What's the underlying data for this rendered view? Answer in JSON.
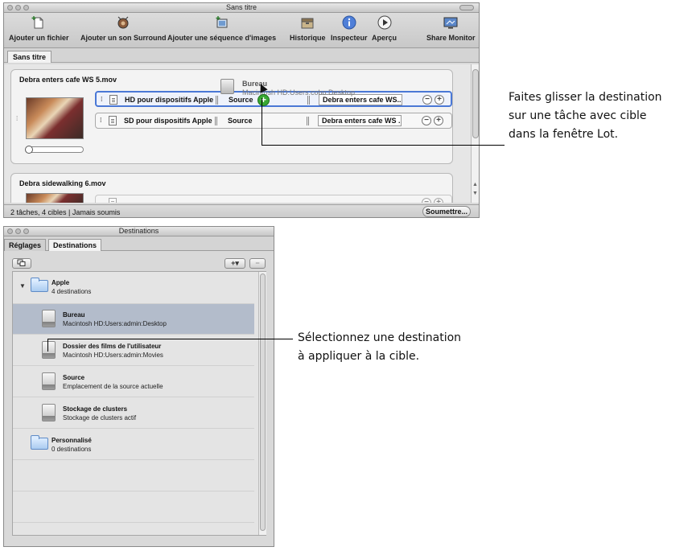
{
  "batch_window": {
    "title": "Sans titre",
    "toolbar": {
      "add_file": "Ajouter un fichier",
      "add_surround": "Ajouter un son Surround",
      "add_sequence": "Ajouter une séquence d'images",
      "history": "Historique",
      "inspector": "Inspecteur",
      "preview": "Aperçu",
      "share_monitor": "Share Monitor"
    },
    "tab": "Sans titre",
    "jobs": [
      {
        "name": "Debra enters cafe WS 5.mov",
        "targets": [
          {
            "setting": "HD pour dispositifs Apple",
            "destination": "Source",
            "output": "Debra enters cafe WS..."
          },
          {
            "setting": "SD pour dispositifs Apple",
            "destination": "Source",
            "output": "Debra enters cafe WS ..."
          }
        ]
      },
      {
        "name": "Debra sidewalking 6.mov"
      }
    ],
    "drag": {
      "name": "Bureau",
      "path": "Macintosh HD:Users:cobo:Desktop"
    },
    "status": "2 tâches, 4 cibles  |  Jamais soumis",
    "submit": "Soumettre..."
  },
  "destinations_window": {
    "title": "Destinations",
    "tabs": [
      "Réglages",
      "Destinations"
    ],
    "groups": [
      {
        "name": "Apple",
        "count": "4 destinations",
        "items": [
          {
            "name": "Bureau",
            "path": "Macintosh HD:Users:admin:Desktop",
            "selected": true
          },
          {
            "name": "Dossier des films de l'utilisateur",
            "path": "Macintosh HD:Users:admin:Movies",
            "selected": false
          },
          {
            "name": "Source",
            "path": "Emplacement de la source actuelle",
            "selected": false
          },
          {
            "name": "Stockage de clusters",
            "path": "Stockage de clusters actif",
            "selected": false
          }
        ]
      },
      {
        "name": "Personnalisé",
        "count": "0 destinations"
      }
    ]
  },
  "callouts": {
    "drag_line1": "Faites glisser la destination",
    "drag_line2": "sur une tâche avec cible",
    "drag_line3": "dans la fenêtre Lot.",
    "select_line1": "Sélectionnez une destination",
    "select_line2": "à appliquer à la cible."
  },
  "colors": {
    "selection_outline": "#4a78d6",
    "selected_row": "#b3bccb",
    "drop_badge": "#38a832"
  }
}
